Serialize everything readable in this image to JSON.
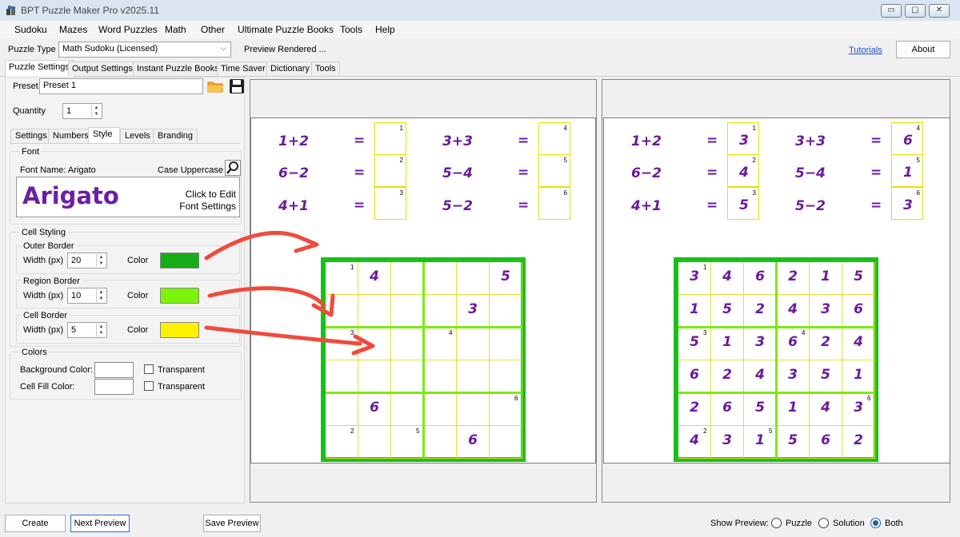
{
  "window": {
    "title": "BPT Puzzle Maker Pro v2025.11",
    "min": "▭",
    "max": "▢",
    "close": "✕"
  },
  "menu": [
    "Sudoku",
    "Mazes",
    "Word Puzzles",
    "Math",
    "Other",
    "Ultimate Puzzle Books",
    "Tools",
    "Help"
  ],
  "puzzle_type": {
    "label": "Puzzle Type",
    "value": "Math Sudoku (Licensed)",
    "status": "Preview Rendered ..."
  },
  "links": {
    "tutorials": "Tutorials",
    "about": "About"
  },
  "main_tabs": [
    "Puzzle Settings",
    "Output Settings",
    "Instant Puzzle Books",
    "Time Saver",
    "Dictionary",
    "Tools"
  ],
  "preset": {
    "label": "Preset",
    "value": "Preset 1"
  },
  "quantity": {
    "label": "Quantity",
    "value": "1"
  },
  "inner_tabs": [
    "Settings",
    "Numbers",
    "Style",
    "Levels",
    "Branding"
  ],
  "font": {
    "group": "Font",
    "name_label": "Font Name: Arigato",
    "case_label": "Case Uppercase",
    "preview_text": "Arigato",
    "edit_line1": "Click to Edit",
    "edit_line2": "Font Settings"
  },
  "cell_styling": {
    "group": "Cell Styling",
    "outer": {
      "title": "Outer Border",
      "width_label": "Width (px)",
      "width": "20",
      "color_label": "Color",
      "color": "#16ad16"
    },
    "region": {
      "title": "Region Border",
      "width_label": "Width (px)",
      "width": "10",
      "color_label": "Color",
      "color": "#7cf30a"
    },
    "cell": {
      "title": "Cell Border",
      "width_label": "Width (px)",
      "width": "5",
      "color_label": "Color",
      "color": "#fff200"
    }
  },
  "colors": {
    "group": "Colors",
    "bg_label": "Background Color:",
    "fill_label": "Cell Fill Color:",
    "transparent": "Transparent"
  },
  "bottom": {
    "create": "Create",
    "next_preview": "Next Preview",
    "save_preview": "Save Preview",
    "show_preview": "Show Preview:",
    "opt_puzzle": "Puzzle",
    "opt_solution": "Solution",
    "opt_both": "Both"
  },
  "equations": [
    {
      "expr": "1+2",
      "n": "1",
      "ans": "3"
    },
    {
      "expr": "6−2",
      "n": "2",
      "ans": "4"
    },
    {
      "expr": "4+1",
      "n": "3",
      "ans": "5"
    },
    {
      "expr": "3+3",
      "n": "4",
      "ans": "6"
    },
    {
      "expr": "5−4",
      "n": "5",
      "ans": "1"
    },
    {
      "expr": "5−2",
      "n": "6",
      "ans": "3"
    }
  ],
  "eq_sign": "=",
  "puzzle_grid": [
    [
      "",
      "4",
      "",
      "",
      "",
      "5"
    ],
    [
      "",
      "",
      "",
      "",
      "3",
      ""
    ],
    [
      "",
      "",
      "",
      "",
      "",
      ""
    ],
    [
      "",
      "",
      "",
      "",
      "",
      ""
    ],
    [
      "",
      "6",
      "",
      "",
      "",
      ""
    ],
    [
      "",
      "",
      "",
      "",
      "6",
      ""
    ]
  ],
  "solution_grid": [
    [
      "3",
      "4",
      "6",
      "2",
      "1",
      "5"
    ],
    [
      "1",
      "5",
      "2",
      "4",
      "3",
      "6"
    ],
    [
      "5",
      "1",
      "3",
      "6",
      "2",
      "4"
    ],
    [
      "6",
      "2",
      "4",
      "3",
      "5",
      "1"
    ],
    [
      "2",
      "6",
      "5",
      "1",
      "4",
      "3"
    ],
    [
      "4",
      "3",
      "1",
      "5",
      "6",
      "2"
    ]
  ],
  "cell_clues": [
    {
      "row": 0,
      "col": 0,
      "n": "1"
    },
    {
      "row": 2,
      "col": 0,
      "n": "3"
    },
    {
      "row": 2,
      "col": 3,
      "n": "4"
    },
    {
      "row": 4,
      "col": 5,
      "n": "6"
    },
    {
      "row": 5,
      "col": 0,
      "n": "2"
    },
    {
      "row": 5,
      "col": 2,
      "n": "5"
    }
  ],
  "icons": {
    "app": "puzzle-app-icon",
    "open": "folder-icon",
    "save": "floppy-disk-icon",
    "search": "magnifier-icon",
    "dropdown": "chevron-down-icon"
  }
}
